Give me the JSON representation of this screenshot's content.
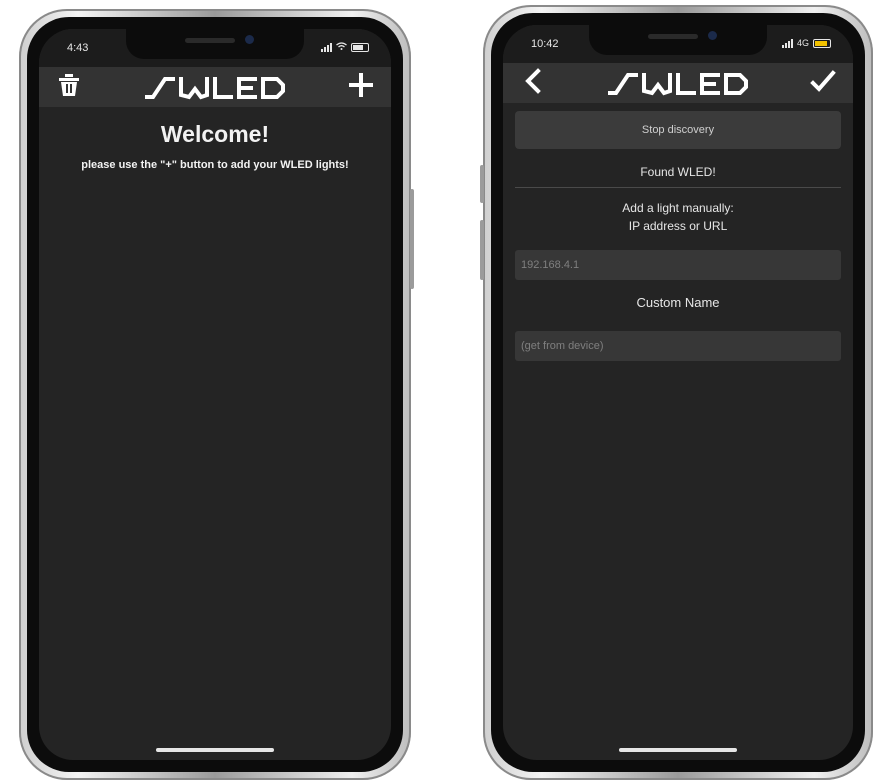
{
  "phone_left": {
    "status": {
      "time": "4:43"
    },
    "navbar": {
      "left_icon": "trash-icon",
      "right_icon": "plus-icon",
      "logo": "WLED"
    },
    "welcome": {
      "title": "Welcome!",
      "message": "please use the \"+\" button to add your WLED lights!"
    }
  },
  "phone_right": {
    "status": {
      "time": "10:42",
      "network": "4G"
    },
    "navbar": {
      "left_icon": "back-chevron-icon",
      "right_icon": "checkmark-icon",
      "logo": "WLED"
    },
    "stop_discovery_label": "Stop discovery",
    "found_text": "Found WLED!",
    "add_manual_line1": "Add a light manually:",
    "add_manual_line2": "IP address or URL",
    "ip_field": {
      "placeholder": "192.168.4.1",
      "value": ""
    },
    "custom_name_label": "Custom Name",
    "name_field": {
      "placeholder": "(get from device)",
      "value": ""
    }
  },
  "colors": {
    "screen_bg": "#242424",
    "navbar_bg": "#333333",
    "field_bg": "#373737",
    "text": "#f2f2f2",
    "battery_low": "#f2c200"
  }
}
